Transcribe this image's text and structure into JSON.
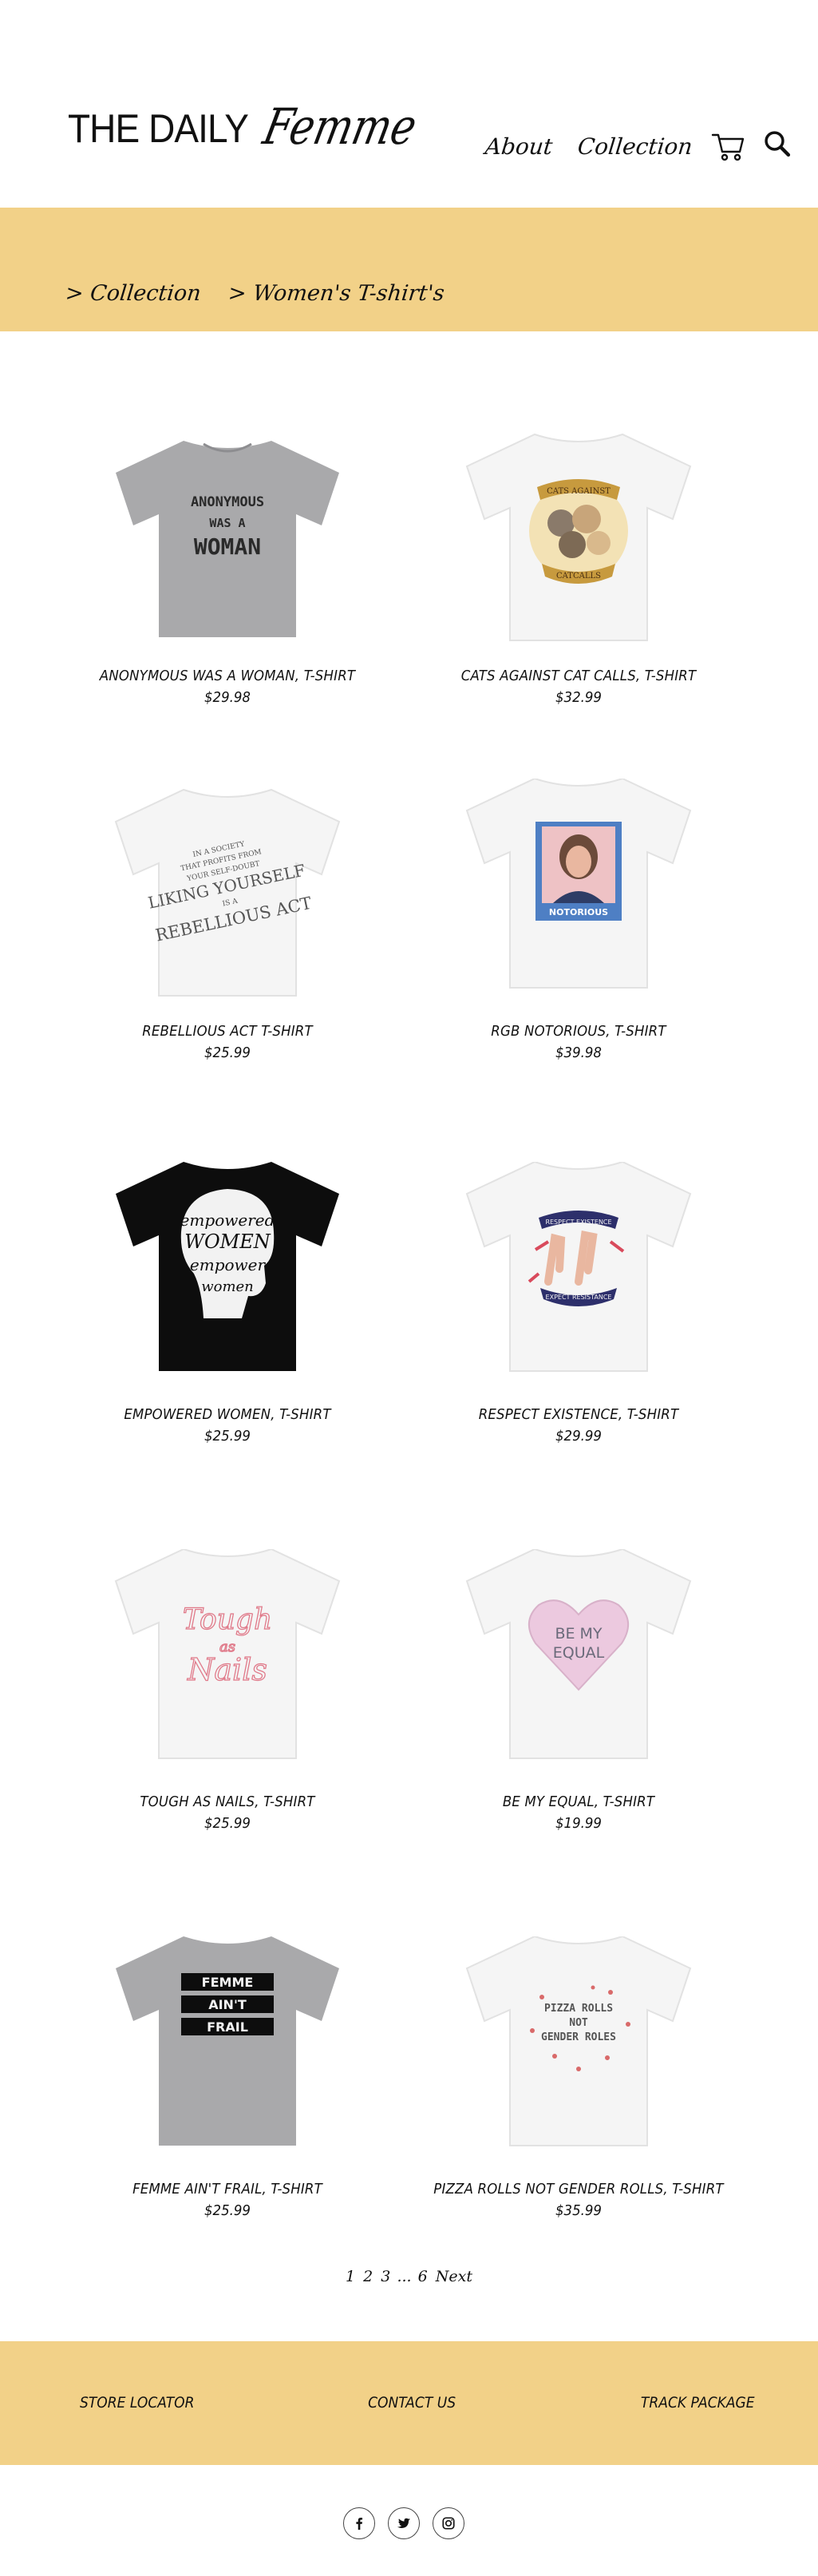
{
  "header": {
    "logo_part1": "THE DAILY",
    "logo_part2": "Femme",
    "nav_about": "About",
    "nav_collection": "Collection",
    "cart_icon": "shopping-cart-icon",
    "search_icon": "magnifier-search-icon"
  },
  "breadcrumb": {
    "item1": "> Collection",
    "item2": "> Women's T-shirt's"
  },
  "colors": {
    "band": "#f2d188",
    "gray_shirt": "#a9a9ab",
    "white_shirt": "#f4f4f4",
    "black_shirt": "#0d0d0d"
  },
  "products": [
    {
      "name": "ANONYMOUS WAS A WOMAN, T-SHIRT",
      "price": "$29.98",
      "print": "ANONYMOUS WAS A WOMAN"
    },
    {
      "name": "CATS AGAINST CAT CALLS, T-SHIRT",
      "price": "$32.99",
      "print": "CATS AGAINST CATCALLS"
    },
    {
      "name": "REBELLIOUS ACT T-SHIRT",
      "price": "$25.99",
      "print": "IN A SOCIETY THAT PROFITS FROM YOUR SELF-DOUBT LIKING YOURSELF IS A REBELLIOUS ACT"
    },
    {
      "name": "RGB NOTORIOUS, T-SHIRT",
      "price": "$39.98",
      "print": "NOTORIOUS"
    },
    {
      "name": "EMPOWERED WOMEN, T-SHIRT",
      "price": "$25.99",
      "print": "EMPOWERED WOMEN EMPOWER WOMEN"
    },
    {
      "name": "RESPECT EXISTENCE, T-SHIRT",
      "price": "$29.99",
      "print": "RESPECT EXISTENCE OR EXPECT RESISTANCE"
    },
    {
      "name": "TOUGH AS NAILS, T-SHIRT",
      "price": "$25.99",
      "print": "Tough as Nails"
    },
    {
      "name": "BE MY EQUAL, T-SHIRT",
      "price": "$19.99",
      "print": "BE MY EQUAL"
    },
    {
      "name": "FEMME AIN'T FRAIL, T-SHIRT",
      "price": "$25.99",
      "print": "FEMME AIN'T FRAIL"
    },
    {
      "name": "PIZZA ROLLS NOT GENDER ROLLS, T-SHIRT",
      "price": "$35.99",
      "print": "PIZZA ROLLS NOT GENDER ROLES"
    }
  ],
  "pagination": {
    "p1": "1",
    "p2": "2",
    "p3": "3",
    "ellipsis": "...",
    "p6": "6",
    "next": "Next"
  },
  "footer": {
    "store_locator": "STORE LOCATOR",
    "contact_us": "CONTACT US",
    "track_package": "TRACK PACKAGE"
  },
  "social": [
    "facebook-icon",
    "twitter-icon",
    "instagram-icon"
  ]
}
